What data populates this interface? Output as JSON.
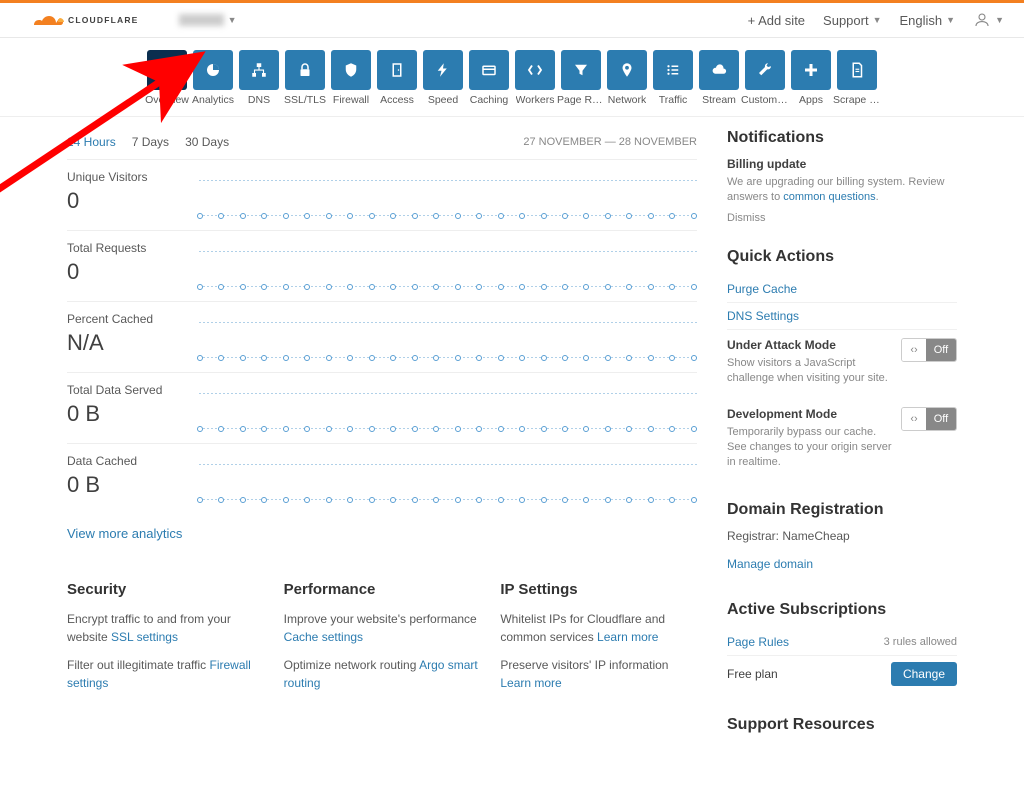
{
  "header": {
    "add_site": "+ Add site",
    "support": "Support",
    "language": "English"
  },
  "nav": [
    {
      "label": "Overview",
      "icon": "clipboard",
      "active": true
    },
    {
      "label": "Analytics",
      "icon": "pie"
    },
    {
      "label": "DNS",
      "icon": "hierarchy"
    },
    {
      "label": "SSL/TLS",
      "icon": "lock"
    },
    {
      "label": "Firewall",
      "icon": "shield"
    },
    {
      "label": "Access",
      "icon": "door"
    },
    {
      "label": "Speed",
      "icon": "bolt"
    },
    {
      "label": "Caching",
      "icon": "card"
    },
    {
      "label": "Workers",
      "icon": "bracket"
    },
    {
      "label": "Page Rules",
      "icon": "filter"
    },
    {
      "label": "Network",
      "icon": "pin"
    },
    {
      "label": "Traffic",
      "icon": "list"
    },
    {
      "label": "Stream",
      "icon": "cloud"
    },
    {
      "label": "Custom Pa...",
      "icon": "wrench"
    },
    {
      "label": "Apps",
      "icon": "plus"
    },
    {
      "label": "Scrape Shi...",
      "icon": "page"
    }
  ],
  "time": {
    "h24": "24 Hours",
    "d7": "7 Days",
    "d30": "30 Days",
    "range": "27 NOVEMBER — 28 NOVEMBER"
  },
  "stats": [
    {
      "label": "Unique Visitors",
      "value": "0"
    },
    {
      "label": "Total Requests",
      "value": "0"
    },
    {
      "label": "Percent Cached",
      "value": "N/A"
    },
    {
      "label": "Total Data Served",
      "value": "0 B"
    },
    {
      "label": "Data Cached",
      "value": "0 B"
    }
  ],
  "view_more": "View more analytics",
  "bottom": {
    "security": {
      "title": "Security",
      "p1a": "Encrypt traffic to and from your website ",
      "p1link": "SSL settings",
      "p2a": "Filter out illegitimate traffic ",
      "p2link": "Firewall settings"
    },
    "performance": {
      "title": "Performance",
      "p1a": "Improve your website's performance ",
      "p1link": "Cache settings",
      "p2a": "Optimize network routing ",
      "p2link": "Argo smart routing"
    },
    "ip": {
      "title": "IP Settings",
      "p1a": "Whitelist IPs for Cloudflare and common services ",
      "p1link": "Learn more",
      "p2a": "Preserve visitors' IP information ",
      "p2link": "Learn more"
    }
  },
  "side": {
    "notifications": {
      "title": "Notifications",
      "billing_title": "Billing update",
      "billing_text": "We are upgrading our billing system. Review answers to ",
      "billing_link": "common questions",
      "dismiss": "Dismiss"
    },
    "quick": {
      "title": "Quick Actions",
      "purge": "Purge Cache",
      "dns": "DNS Settings",
      "attack_title": "Under Attack Mode",
      "attack_desc": "Show visitors a JavaScript challenge when visiting your site.",
      "dev_title": "Development Mode",
      "dev_desc": "Temporarily bypass our cache. See changes to your origin server in realtime.",
      "off": "Off"
    },
    "domain": {
      "title": "Domain Registration",
      "registrar": "Registrar: NameCheap",
      "manage": "Manage domain"
    },
    "subs": {
      "title": "Active Subscriptions",
      "pagerules": "Page Rules",
      "allowed": "3 rules allowed",
      "free": "Free plan",
      "change": "Change"
    },
    "support": {
      "title": "Support Resources"
    }
  }
}
